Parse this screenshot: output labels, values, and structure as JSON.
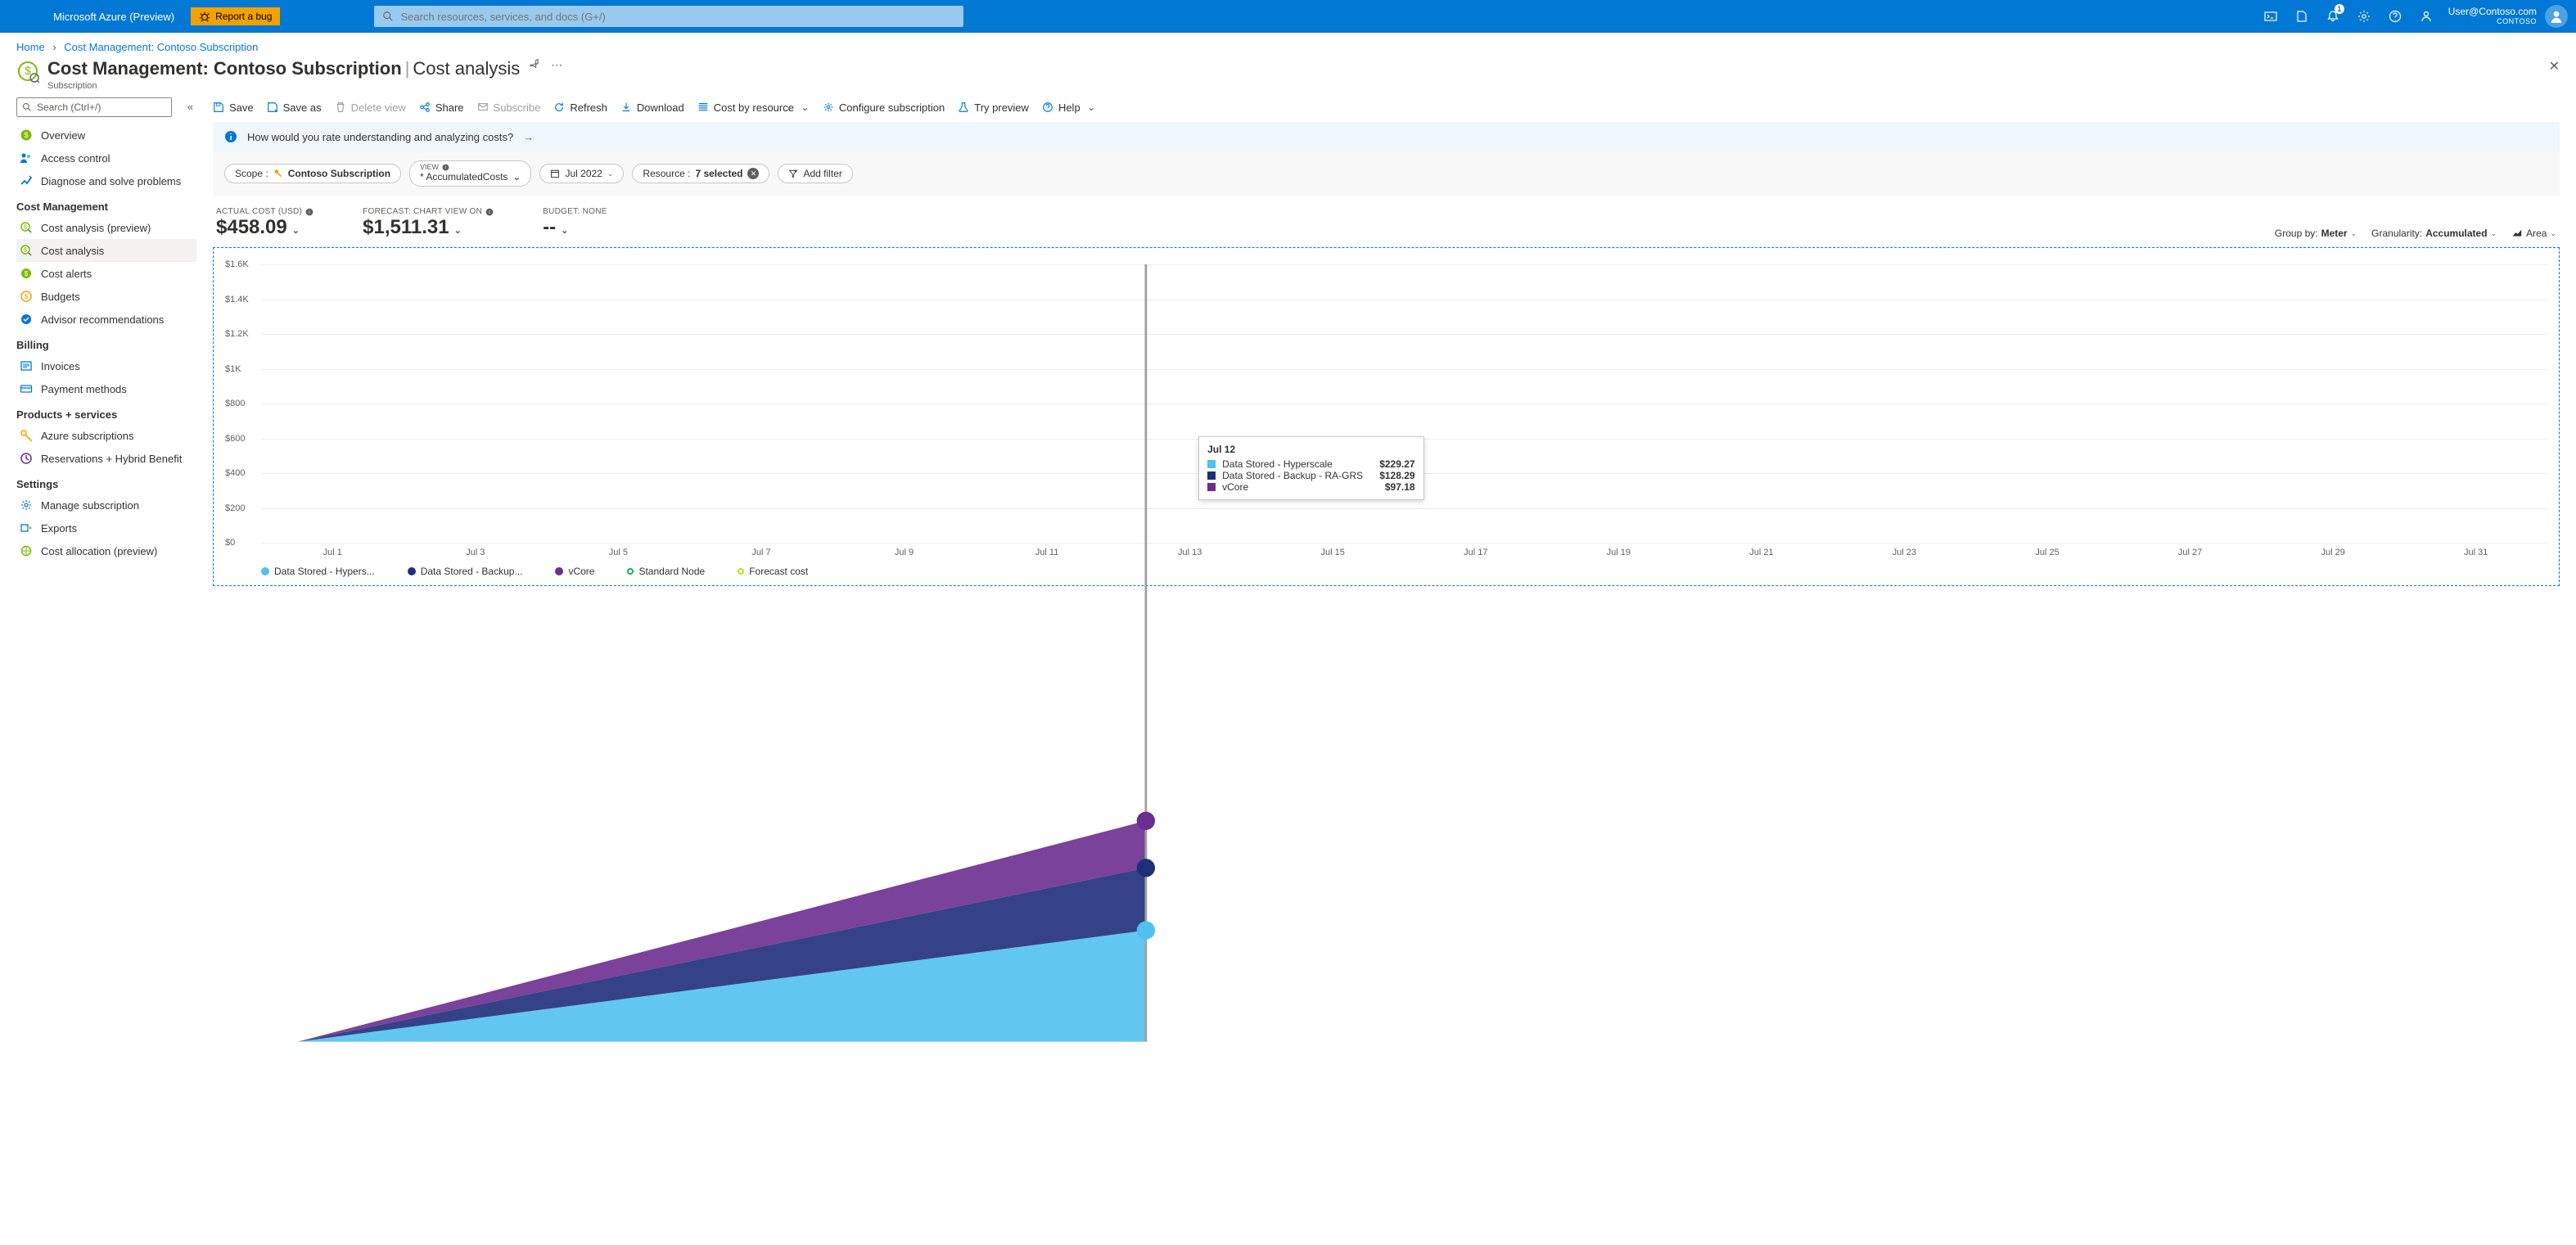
{
  "topbar": {
    "brand": "Microsoft Azure (Preview)",
    "bug_label": "Report a bug",
    "search_placeholder": "Search resources, services, and docs (G+/)",
    "notif_count": "1",
    "user_email": "User@Contoso.com",
    "user_org": "CONTOSO"
  },
  "breadcrumb": {
    "home": "Home",
    "current": "Cost Management: Contoso Subscription"
  },
  "title": {
    "main": "Cost Management: Contoso Subscription",
    "section": "Cost analysis",
    "subtitle": "Subscription"
  },
  "sidebar": {
    "search_placeholder": "Search (Ctrl+/)",
    "top": [
      {
        "label": "Overview"
      },
      {
        "label": "Access control"
      },
      {
        "label": "Diagnose and solve problems"
      }
    ],
    "groups": [
      {
        "heading": "Cost Management",
        "items": [
          {
            "label": "Cost analysis (preview)"
          },
          {
            "label": "Cost analysis",
            "active": true
          },
          {
            "label": "Cost alerts"
          },
          {
            "label": "Budgets"
          },
          {
            "label": "Advisor recommendations"
          }
        ]
      },
      {
        "heading": "Billing",
        "items": [
          {
            "label": "Invoices"
          },
          {
            "label": "Payment methods"
          }
        ]
      },
      {
        "heading": "Products + services",
        "items": [
          {
            "label": "Azure subscriptions"
          },
          {
            "label": "Reservations + Hybrid Benefit"
          }
        ]
      },
      {
        "heading": "Settings",
        "items": [
          {
            "label": "Manage subscription"
          },
          {
            "label": "Exports"
          },
          {
            "label": "Cost allocation (preview)"
          }
        ]
      }
    ]
  },
  "toolbar": {
    "save": "Save",
    "save_as": "Save as",
    "delete_view": "Delete view",
    "share": "Share",
    "subscribe": "Subscribe",
    "refresh": "Refresh",
    "download": "Download",
    "cost_by_resource": "Cost by resource",
    "configure": "Configure subscription",
    "try_preview": "Try preview",
    "help": "Help"
  },
  "banner": {
    "text": "How would you rate understanding and analyzing costs?"
  },
  "filterbar": {
    "scope_label": "Scope :",
    "scope_value": "Contoso Subscription",
    "view_label": "VIEW",
    "view_value": "* AccumulatedCosts",
    "date": "Jul 2022",
    "resource_label": "Resource :",
    "resource_value": "7 selected",
    "add_filter": "Add filter"
  },
  "metrics": {
    "actual_label": "ACTUAL COST (USD)",
    "actual_value": "$458.09",
    "forecast_label": "FORECAST: CHART VIEW ON",
    "forecast_value": "$1,511.31",
    "budget_label": "BUDGET: NONE",
    "budget_value": "--"
  },
  "chart_controls": {
    "groupby_label": "Group by:",
    "groupby_value": "Meter",
    "granularity_label": "Granularity:",
    "granularity_value": "Accumulated",
    "charttype": "Area"
  },
  "chart_data": {
    "type": "area",
    "ylabel": "",
    "ylim": [
      0,
      1600
    ],
    "yticks": [
      "$0",
      "$200",
      "$400",
      "$600",
      "$800",
      "$1K",
      "$1.2K",
      "$1.4K",
      "$1.6K"
    ],
    "x_categories": [
      "Jul 1",
      "Jul 3",
      "Jul 5",
      "Jul 7",
      "Jul 9",
      "Jul 11",
      "Jul 13",
      "Jul 15",
      "Jul 17",
      "Jul 19",
      "Jul 21",
      "Jul 23",
      "Jul 25",
      "Jul 27",
      "Jul 29",
      "Jul 31"
    ],
    "series": [
      {
        "name": "Data Stored - Hypers...",
        "full_name": "Data Stored - Hyperscale",
        "color": "#50c1ee",
        "values_at_jul12": 229.27
      },
      {
        "name": "Data Stored - Backup...",
        "full_name": "Data Stored - Backup - RA-GRS",
        "color": "#1f2e7a",
        "values_at_jul12": 128.29
      },
      {
        "name": "vCore",
        "full_name": "vCore",
        "color": "#6b2d90",
        "values_at_jul12": 97.18
      },
      {
        "name": "Standard Node",
        "full_name": "Standard Node",
        "color": "#1aaf5d",
        "ring": true
      },
      {
        "name": "Forecast cost",
        "full_name": "Forecast cost",
        "color": "#b5e61d",
        "ring": true
      }
    ],
    "tooltip": {
      "title": "Jul 12",
      "rows": [
        {
          "color": "#50c1ee",
          "name": "Data Stored - Hyperscale",
          "value": "$229.27"
        },
        {
          "color": "#1f2e7a",
          "name": "Data Stored - Backup - RA-GRS",
          "value": "$128.29"
        },
        {
          "color": "#6b2d90",
          "name": "vCore",
          "value": "$97.18"
        }
      ]
    }
  }
}
